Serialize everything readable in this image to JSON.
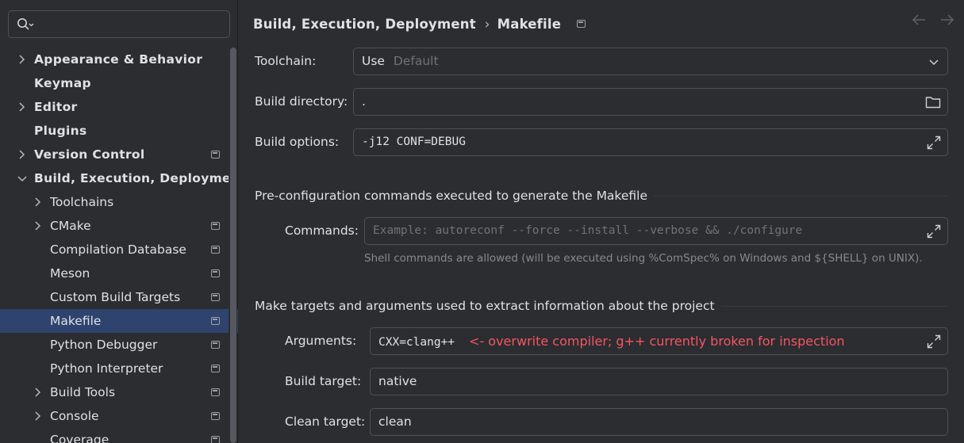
{
  "search": {
    "placeholder": "",
    "value": ""
  },
  "sidebar": {
    "items": [
      {
        "label": "Appearance & Behavior",
        "level": 0,
        "expandable": true,
        "expanded": false,
        "modified": false,
        "selected": false
      },
      {
        "label": "Keymap",
        "level": 0,
        "expandable": false,
        "modified": false,
        "selected": false
      },
      {
        "label": "Editor",
        "level": 0,
        "expandable": true,
        "expanded": false,
        "modified": false,
        "selected": false
      },
      {
        "label": "Plugins",
        "level": 0,
        "expandable": false,
        "modified": false,
        "selected": false
      },
      {
        "label": "Version Control",
        "level": 0,
        "expandable": true,
        "expanded": false,
        "modified": true,
        "selected": false
      },
      {
        "label": "Build, Execution, Deployme",
        "level": 0,
        "expandable": true,
        "expanded": true,
        "modified": false,
        "selected": false
      },
      {
        "label": "Toolchains",
        "level": 1,
        "expandable": true,
        "expanded": false,
        "modified": false,
        "selected": false
      },
      {
        "label": "CMake",
        "level": 1,
        "expandable": true,
        "expanded": false,
        "modified": true,
        "selected": false
      },
      {
        "label": "Compilation Database",
        "level": 1,
        "expandable": false,
        "modified": true,
        "selected": false
      },
      {
        "label": "Meson",
        "level": 1,
        "expandable": false,
        "modified": true,
        "selected": false
      },
      {
        "label": "Custom Build Targets",
        "level": 1,
        "expandable": false,
        "modified": true,
        "selected": false
      },
      {
        "label": "Makefile",
        "level": 1,
        "expandable": false,
        "modified": true,
        "selected": true
      },
      {
        "label": "Python Debugger",
        "level": 1,
        "expandable": false,
        "modified": true,
        "selected": false
      },
      {
        "label": "Python Interpreter",
        "level": 1,
        "expandable": false,
        "modified": true,
        "selected": false
      },
      {
        "label": "Build Tools",
        "level": 1,
        "expandable": true,
        "expanded": false,
        "modified": true,
        "selected": false
      },
      {
        "label": "Console",
        "level": 1,
        "expandable": true,
        "expanded": false,
        "modified": true,
        "selected": false
      },
      {
        "label": "Coverage",
        "level": 1,
        "expandable": false,
        "modified": true,
        "selected": false
      }
    ]
  },
  "header": {
    "breadcrumb_parent": "Build, Execution, Deployment",
    "breadcrumb_separator": "›",
    "breadcrumb_current": "Makefile",
    "back_icon": "arrow-left-icon",
    "forward_icon": "arrow-right-icon"
  },
  "form": {
    "toolchain": {
      "label": "Toolchain:",
      "prefix": "Use",
      "value": "Default"
    },
    "build_directory": {
      "label": "Build directory:",
      "value": "."
    },
    "build_options": {
      "label": "Build options:",
      "value": "-j12 CONF=DEBUG"
    }
  },
  "preconfig": {
    "title": "Pre-configuration commands executed to generate the Makefile",
    "commands_label": "Commands:",
    "commands_placeholder": "Example: autoreconf --force --install --verbose && ./configure",
    "commands_value": "",
    "hint": "Shell commands are allowed (will be executed using %ComSpec% on Windows and ${SHELL} on UNIX)."
  },
  "targets": {
    "title": "Make targets and arguments used to extract information about the project",
    "arguments_label": "Arguments:",
    "arguments_value": "CXX=clang++",
    "arguments_annotation": "<- overwrite compiler; g++ currently broken for inspection",
    "build_target_label": "Build target:",
    "build_target_value": "native",
    "clean_target_label": "Clean target:",
    "clean_target_value": "clean"
  },
  "colors": {
    "background": "#2b2d30",
    "selection": "#2e436e",
    "border": "#4e5157",
    "text": "#dfe1e5",
    "muted": "#868a91",
    "annotation": "#f75464"
  }
}
